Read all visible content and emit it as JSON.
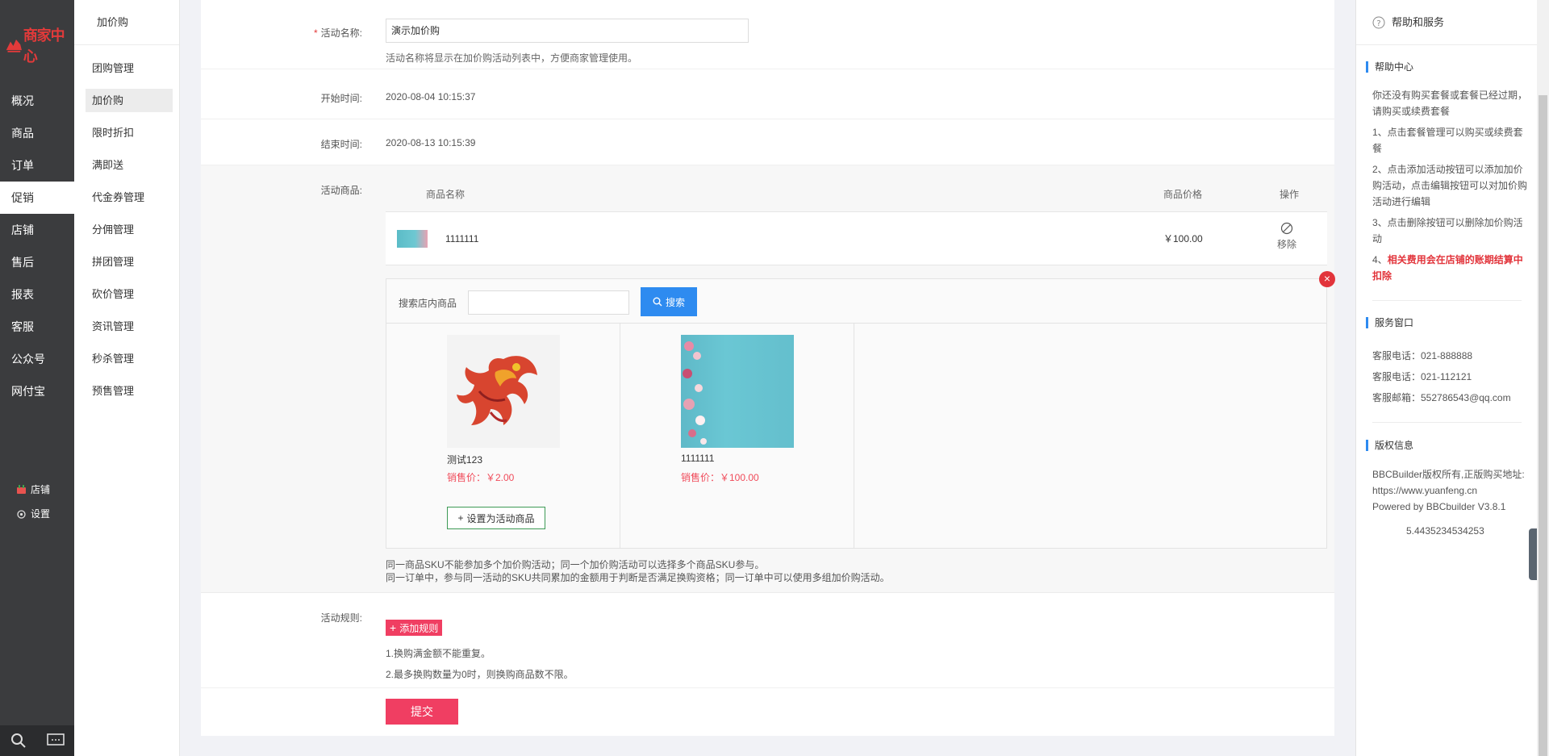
{
  "brand": {
    "logo_text": "商家中心"
  },
  "main_nav": {
    "items": [
      {
        "label": "概况"
      },
      {
        "label": "商品"
      },
      {
        "label": "订单"
      },
      {
        "label": "促销"
      },
      {
        "label": "店铺"
      },
      {
        "label": "售后"
      },
      {
        "label": "报表"
      },
      {
        "label": "客服"
      },
      {
        "label": "公众号"
      },
      {
        "label": "网付宝"
      }
    ],
    "active": "促销",
    "bottom": {
      "shop_label": "店铺",
      "settings_label": "设置"
    }
  },
  "sub_nav": {
    "title": "加价购",
    "items": [
      {
        "label": "团购管理"
      },
      {
        "label": "加价购"
      },
      {
        "label": "限时折扣"
      },
      {
        "label": "满即送"
      },
      {
        "label": "代金券管理"
      },
      {
        "label": "分佣管理"
      },
      {
        "label": "拼团管理"
      },
      {
        "label": "砍价管理"
      },
      {
        "label": "资讯管理"
      },
      {
        "label": "秒杀管理"
      },
      {
        "label": "预售管理"
      }
    ]
  },
  "form": {
    "name_label": "活动名称:",
    "name_value": "演示加价购",
    "name_hint": "活动名称将显示在加价购活动列表中，方便商家管理使用。",
    "start_label": "开始时间:",
    "start_value": "2020-08-04 10:15:37",
    "end_label": "结束时间:",
    "end_value": "2020-08-13 10:15:39",
    "goods_label": "活动商品:",
    "table": {
      "col_name": "商品名称",
      "col_price": "商品价格",
      "col_action": "操作",
      "rows": [
        {
          "name": "1111111",
          "price": "￥100.00",
          "action": "移除"
        }
      ]
    },
    "picker": {
      "search_label": "搜索店内商品",
      "search_value": "",
      "search_button": "搜索",
      "close_symbol": "×",
      "products": [
        {
          "name": "测试123",
          "price": "销售价：￥2.00",
          "action": "设置为活动商品"
        },
        {
          "name": "1111111",
          "price": "销售价：￥100.00"
        }
      ]
    },
    "notes": [
      "同一商品SKU不能参加多个加价购活动；同一个加价购活动可以选择多个商品SKU参与。",
      "同一订单中，参与同一活动的SKU共同累加的金额用于判断是否满足换购资格；同一订单中可以使用多组加价购活动。"
    ],
    "rules_label": "活动规则:",
    "add_rule_button": "添加规则",
    "rule_notes": [
      "1.换购满金额不能重复。",
      "2.最多换购数量为0时，则换购商品数不限。"
    ],
    "submit_button": "提交"
  },
  "help": {
    "title": "帮助和服务",
    "center_title": "帮助中心",
    "center_items": [
      "你还没有购买套餐或套餐已经过期，请购买或续费套餐",
      "1、点击套餐管理可以购买或续费套餐",
      "2、点击添加活动按钮可以添加加价购活动，点击编辑按钮可以对加价购活动进行编辑",
      "3、点击删除按钮可以删除加价购活动"
    ],
    "center_last_prefix": "4、",
    "center_last_red": "相关费用会在店铺的账期结算中扣除",
    "service_title": "服务窗口",
    "service_items": [
      "客服电话：021-888888",
      "客服电话：021-112121",
      "客服邮箱：552786543@qq.com"
    ],
    "copyright_title": "版权信息",
    "copyright_items": [
      "BBCBuilder版权所有,正版购买地址:",
      "https://www.yuanfeng.cn",
      "Powered by BBCbuilder V3.8.1"
    ],
    "version_number": "5.4435234534253"
  },
  "colors": {
    "accent_pink": "#f03e62",
    "accent_blue": "#2e8bf0",
    "sidebar_dark": "#3b3c3e"
  }
}
